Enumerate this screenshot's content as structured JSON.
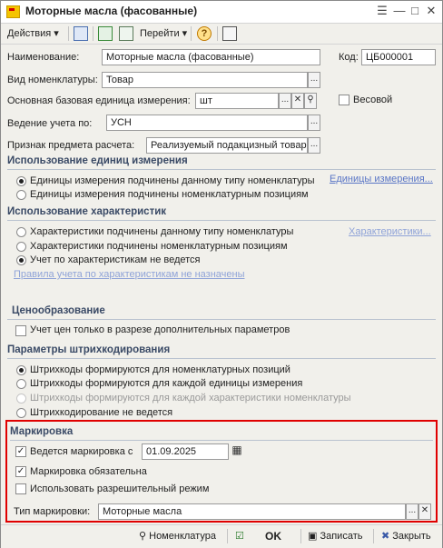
{
  "window": {
    "title": "Моторные масла (фасованные)"
  },
  "toolbar": {
    "actions_label": "Действия",
    "goto_label": "Перейти"
  },
  "form": {
    "name_label": "Наименование:",
    "name_value": "Моторные масла (фасованные)",
    "code_label": "Код:",
    "code_value": "ЦБ000001",
    "kind_label": "Вид номенклатуры:",
    "kind_value": "Товар",
    "unit_label": "Основная базовая единица измерения:",
    "unit_value": "шт",
    "weight_label": "Весовой",
    "accounting_label": "Ведение учета по:",
    "accounting_value": "УСН",
    "calc_label": "Признак предмета расчета:",
    "calc_value": "Реализуемый подакцизный товар"
  },
  "units_section": {
    "title": "Использование единиц измерения",
    "options": [
      "Единицы измерения подчинены данному типу номенклатуры",
      "Единицы измерения подчинены номенклатурным позициям"
    ],
    "link": "Единицы измерения..."
  },
  "chars_section": {
    "title": "Использование характеристик",
    "options": [
      "Характеристики подчинены данному типу номенклатуры",
      "Характеристики подчинены номенклатурным позициям",
      "Учет по характеристикам не ведется"
    ],
    "link": "Характеристики...",
    "rules_link": "Правила учета по характеристикам не назначены"
  },
  "price_section": {
    "title": "Ценообразование",
    "check_label": "Учет цен только в разрезе дополнительных параметров"
  },
  "barcode_section": {
    "title": "Параметры штрихкодирования",
    "options": [
      "Штрихкоды формируются для номенклатурных позиций",
      "Штрихкоды формируются для каждой единицы измерения",
      "Штрихкоды формируются для каждой характеристики номенклатуры",
      "Штрихкодирование не ведется"
    ]
  },
  "marking_section": {
    "title": "Маркировка",
    "marking_label": "Ведется маркировка с",
    "marking_date": "01.09.2025",
    "mandatory_label": "Маркировка обязательна",
    "permit_label": "Использовать разрешительный режим",
    "type_label": "Тип маркировки:",
    "type_value": "Моторные масла"
  },
  "bottom": {
    "nomenclature_label": "Номенклатура",
    "ok_label": "OK",
    "save_label": "Записать",
    "close_label": "Закрыть"
  }
}
